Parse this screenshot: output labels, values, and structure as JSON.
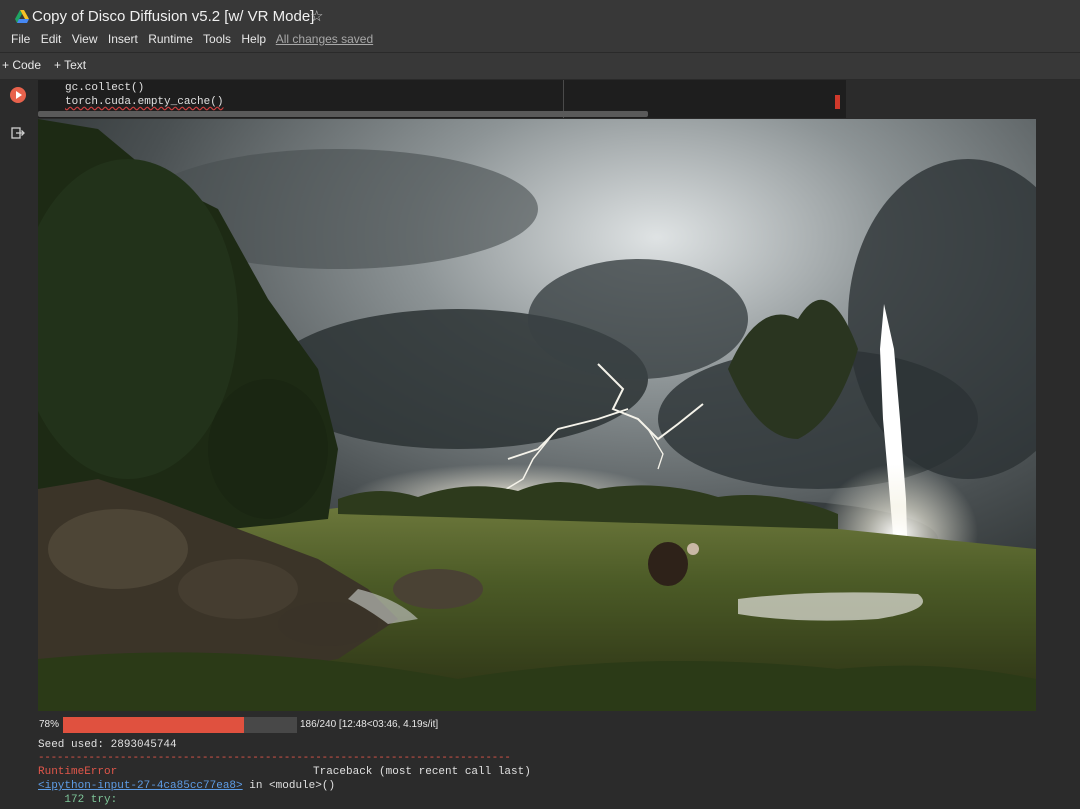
{
  "header": {
    "title": "Copy of Disco Diffusion v5.2 [w/ VR Mode]",
    "star_icon": "star-outline-icon",
    "menu": [
      "File",
      "Edit",
      "View",
      "Insert",
      "Runtime",
      "Tools",
      "Help"
    ],
    "save_status": "All changes saved"
  },
  "toolbar": {
    "code_label": "+ Code",
    "text_label": "+ Text"
  },
  "cell": {
    "code_lines": [
      "gc.collect()",
      "torch.cuda.empty_cache()"
    ],
    "run_icon": "play-circle-icon",
    "output_icon": "output-exit-icon"
  },
  "output": {
    "image_description_icon": "landscape-image",
    "progress": {
      "percent_label": "78%",
      "fraction": 0.775,
      "stats": "186/240 [12:48<03:46, 4.19s/it]"
    },
    "seed_line": "Seed used: 2893045744",
    "divider": "---------------------------------------------------------------------------",
    "error_name": "RuntimeError",
    "traceback_label": "Traceback (most recent call last)",
    "ipython_link": "<ipython-input-27-4ca85cc77ea8>",
    "ipython_suffix": " in <module>()",
    "try_line": "    172 try:"
  },
  "colors": {
    "accent_progress": "#e0513f",
    "error_red": "#e0564a",
    "link_blue": "#5e9de6",
    "run_button": "#e8624c"
  }
}
